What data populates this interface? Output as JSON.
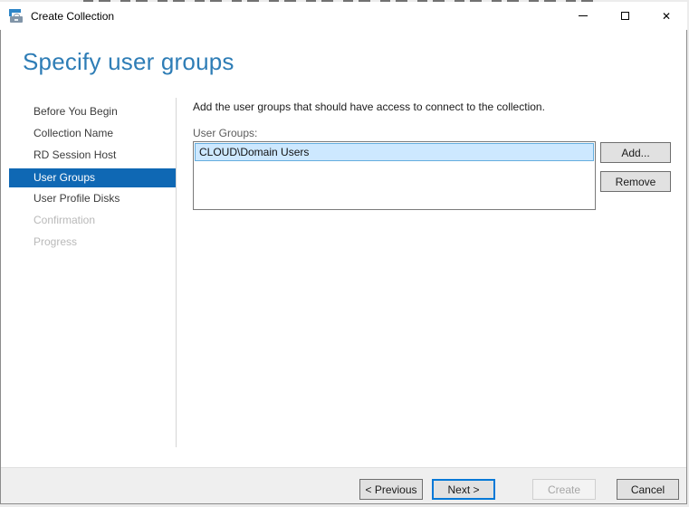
{
  "window": {
    "title": "Create Collection",
    "icons": {
      "close_glyph": "✕"
    }
  },
  "header": {
    "title": "Specify user groups"
  },
  "sidebar": {
    "items": [
      {
        "label": "Before You Begin",
        "state": "enabled"
      },
      {
        "label": "Collection Name",
        "state": "enabled"
      },
      {
        "label": "RD Session Host",
        "state": "enabled"
      },
      {
        "label": "User Groups",
        "state": "selected"
      },
      {
        "label": "User Profile Disks",
        "state": "enabled"
      },
      {
        "label": "Confirmation",
        "state": "disabled"
      },
      {
        "label": "Progress",
        "state": "disabled"
      }
    ]
  },
  "content": {
    "instruction": "Add the user groups that should have access to connect to the collection.",
    "list_label": "User Groups:",
    "list_items": [
      "CLOUD\\Domain Users"
    ],
    "add_label": "Add...",
    "remove_label": "Remove"
  },
  "footer": {
    "previous_label": "< Previous",
    "next_label": "Next >",
    "create_label": "Create",
    "cancel_label": "Cancel"
  },
  "colors": {
    "heading_blue": "#2e7db6",
    "sidebar_selected": "#0f68b4",
    "list_selection_fill": "#cde8ff",
    "list_selection_border": "#66aede",
    "focus_border": "#0078d7",
    "button_fill": "#e1e1e1",
    "footer_background": "#efefef"
  }
}
